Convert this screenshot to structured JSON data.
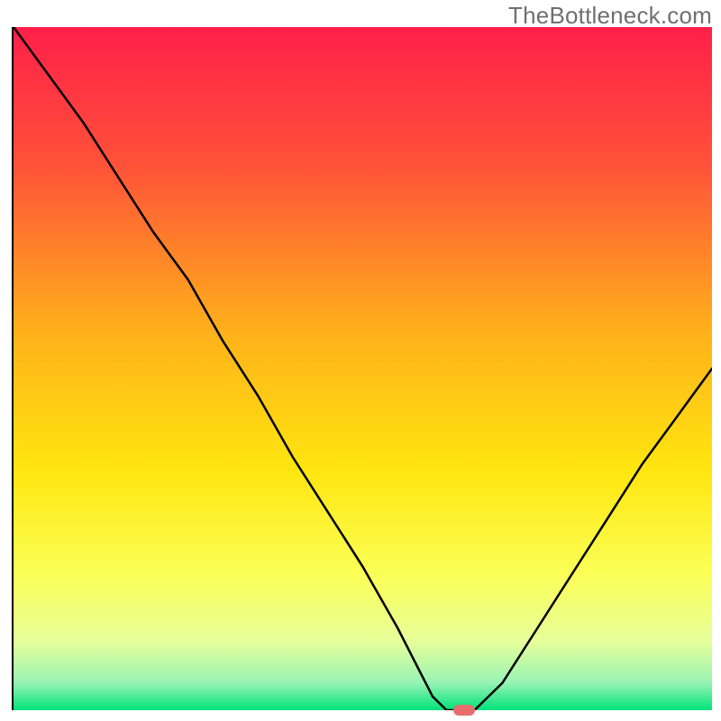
{
  "watermark": "TheBottleneck.com",
  "chart_data": {
    "type": "line",
    "title": "",
    "xlabel": "",
    "ylabel": "",
    "xlim": [
      0,
      100
    ],
    "ylim": [
      0,
      100
    ],
    "x": [
      0,
      5,
      10,
      15,
      20,
      25,
      30,
      35,
      40,
      45,
      50,
      55,
      58,
      60,
      62,
      64,
      66,
      70,
      75,
      80,
      85,
      90,
      95,
      100
    ],
    "values": [
      100,
      93,
      86,
      78,
      70,
      63,
      54,
      46,
      37,
      29,
      21,
      12,
      6,
      2,
      0,
      0,
      0,
      4,
      12,
      20,
      28,
      36,
      43,
      50
    ],
    "marker": {
      "x": 64.5,
      "y": 0
    },
    "gradient_stops": [
      {
        "pos": 0.0,
        "color": "#ff1f4a"
      },
      {
        "pos": 0.2,
        "color": "#ff5139"
      },
      {
        "pos": 0.45,
        "color": "#ffb21a"
      },
      {
        "pos": 0.65,
        "color": "#ffe60f"
      },
      {
        "pos": 0.8,
        "color": "#fbff56"
      },
      {
        "pos": 0.9,
        "color": "#e6ff9a"
      },
      {
        "pos": 0.96,
        "color": "#97f3b4"
      },
      {
        "pos": 1.0,
        "color": "#00e37a"
      }
    ]
  }
}
